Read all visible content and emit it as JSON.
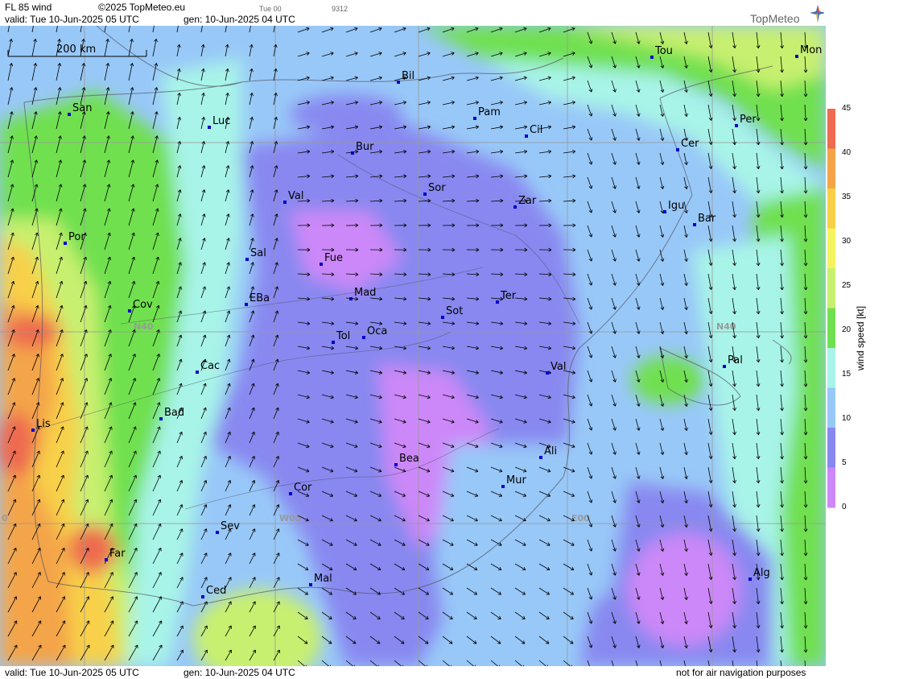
{
  "header": {
    "title": "FL 85 wind",
    "copyright": "©2025 TopMeteo.eu",
    "run_code": "Tue 00",
    "run_number": "9312",
    "valid": "valid:  Tue  10-Jun-2025  05 UTC",
    "generated": "gen: 10-Jun-2025 04 UTC",
    "logo": "TopMeteo"
  },
  "footer": {
    "valid": "valid:  Tue  10-Jun-2025  05 UTC",
    "generated": "gen: 10-Jun-2025 04 UTC",
    "disclaimer": "not for air navigation purposes"
  },
  "scale": {
    "label": "200 km"
  },
  "legend": {
    "title": "wind speed [kt]",
    "ticks": [
      "45",
      "40",
      "35",
      "30",
      "25",
      "20",
      "15",
      "10",
      "5",
      "0"
    ],
    "colors": [
      "#ee6a50",
      "#f4a448",
      "#f8d048",
      "#f4f460",
      "#c8f070",
      "#70e050",
      "#a8f4e8",
      "#98c8f8",
      "#8888f0",
      "#cc88f8"
    ]
  },
  "gridlines": {
    "labels": [
      "N40",
      "N40",
      "W05",
      "E00",
      "0"
    ]
  },
  "cities": [
    {
      "name": "Tou"
    },
    {
      "name": "Mon"
    },
    {
      "name": "Bil"
    },
    {
      "name": "San"
    },
    {
      "name": "Pam"
    },
    {
      "name": "Luc"
    },
    {
      "name": "Cil"
    },
    {
      "name": "Per"
    },
    {
      "name": "Bur"
    },
    {
      "name": "Cer"
    },
    {
      "name": "Sor"
    },
    {
      "name": "Val"
    },
    {
      "name": "Zar"
    },
    {
      "name": "Igu"
    },
    {
      "name": "Bar"
    },
    {
      "name": "Por"
    },
    {
      "name": "Sal"
    },
    {
      "name": "Fue"
    },
    {
      "name": "Mad"
    },
    {
      "name": "EBa"
    },
    {
      "name": "Ter"
    },
    {
      "name": "Cov"
    },
    {
      "name": "Sot"
    },
    {
      "name": "Oca"
    },
    {
      "name": "Tol"
    },
    {
      "name": "Val"
    },
    {
      "name": "Pal"
    },
    {
      "name": "Cac"
    },
    {
      "name": "Bad"
    },
    {
      "name": "Lis"
    },
    {
      "name": "Bea"
    },
    {
      "name": "Ali"
    },
    {
      "name": "Mur"
    },
    {
      "name": "Cor"
    },
    {
      "name": "Sev"
    },
    {
      "name": "Far"
    },
    {
      "name": "Mal"
    },
    {
      "name": "Alg"
    },
    {
      "name": "Ced"
    }
  ]
}
